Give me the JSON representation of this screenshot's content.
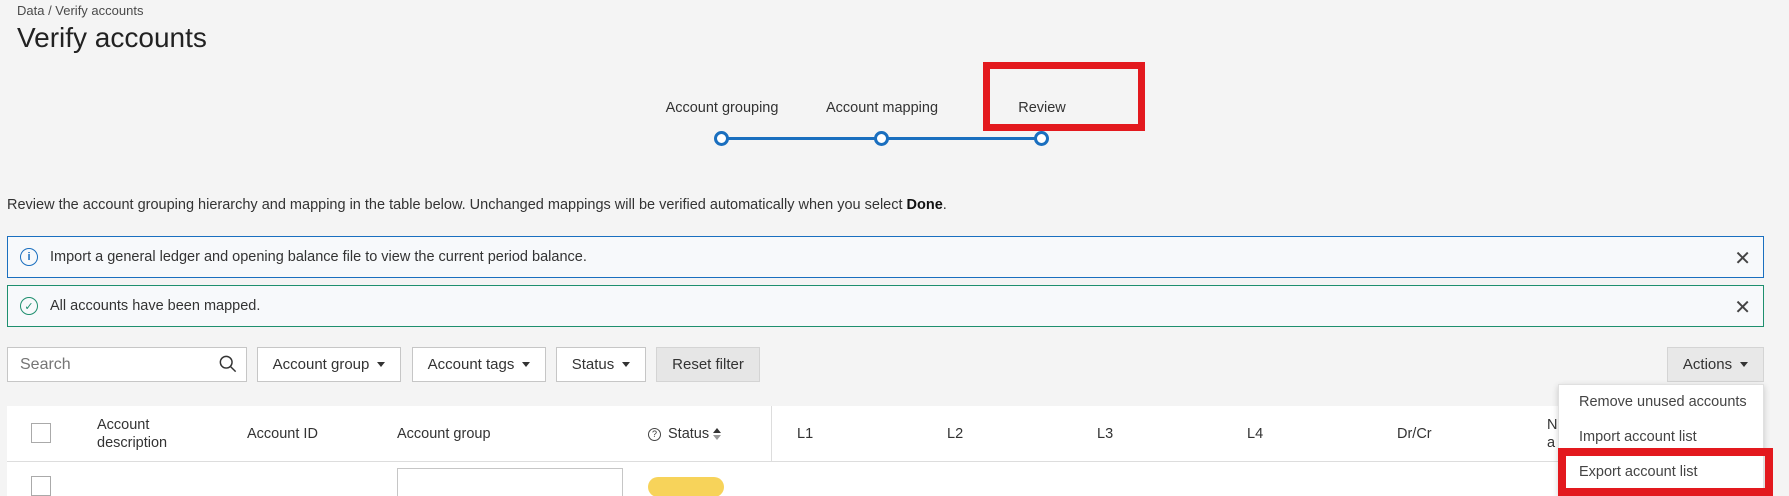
{
  "breadcrumb": "Data / Verify accounts",
  "page_title": "Verify accounts",
  "stepper": {
    "steps": [
      {
        "label": "Account grouping"
      },
      {
        "label": "Account mapping"
      },
      {
        "label": "Review"
      }
    ]
  },
  "intro": {
    "text": "Review the account grouping hierarchy and mapping in the table below. Unchanged mappings will be verified automatically when you select ",
    "bold": "Done",
    "suffix": "."
  },
  "banners": {
    "info": "Import a general ledger and opening balance file to view the current period balance.",
    "success": "All accounts have been mapped."
  },
  "toolbar": {
    "search_placeholder": "Search",
    "account_group": "Account group",
    "account_tags": "Account tags",
    "status": "Status",
    "reset_filter": "Reset filter",
    "actions": "Actions"
  },
  "table": {
    "columns": {
      "account_description": "Account description",
      "account_id": "Account ID",
      "account_group": "Account group",
      "status": "Status",
      "l1": "L1",
      "l2": "L2",
      "l3": "L3",
      "l4": "L4",
      "dr_cr": "Dr/Cr",
      "truncated": "N a"
    }
  },
  "actions_menu": {
    "items": [
      "Remove unused accounts",
      "Import account list",
      "Export account list"
    ]
  },
  "colors": {
    "accent": "#1a6fbf",
    "success": "#1e8f6e",
    "highlight": "#e3191e",
    "badge": "#f7d35a"
  }
}
